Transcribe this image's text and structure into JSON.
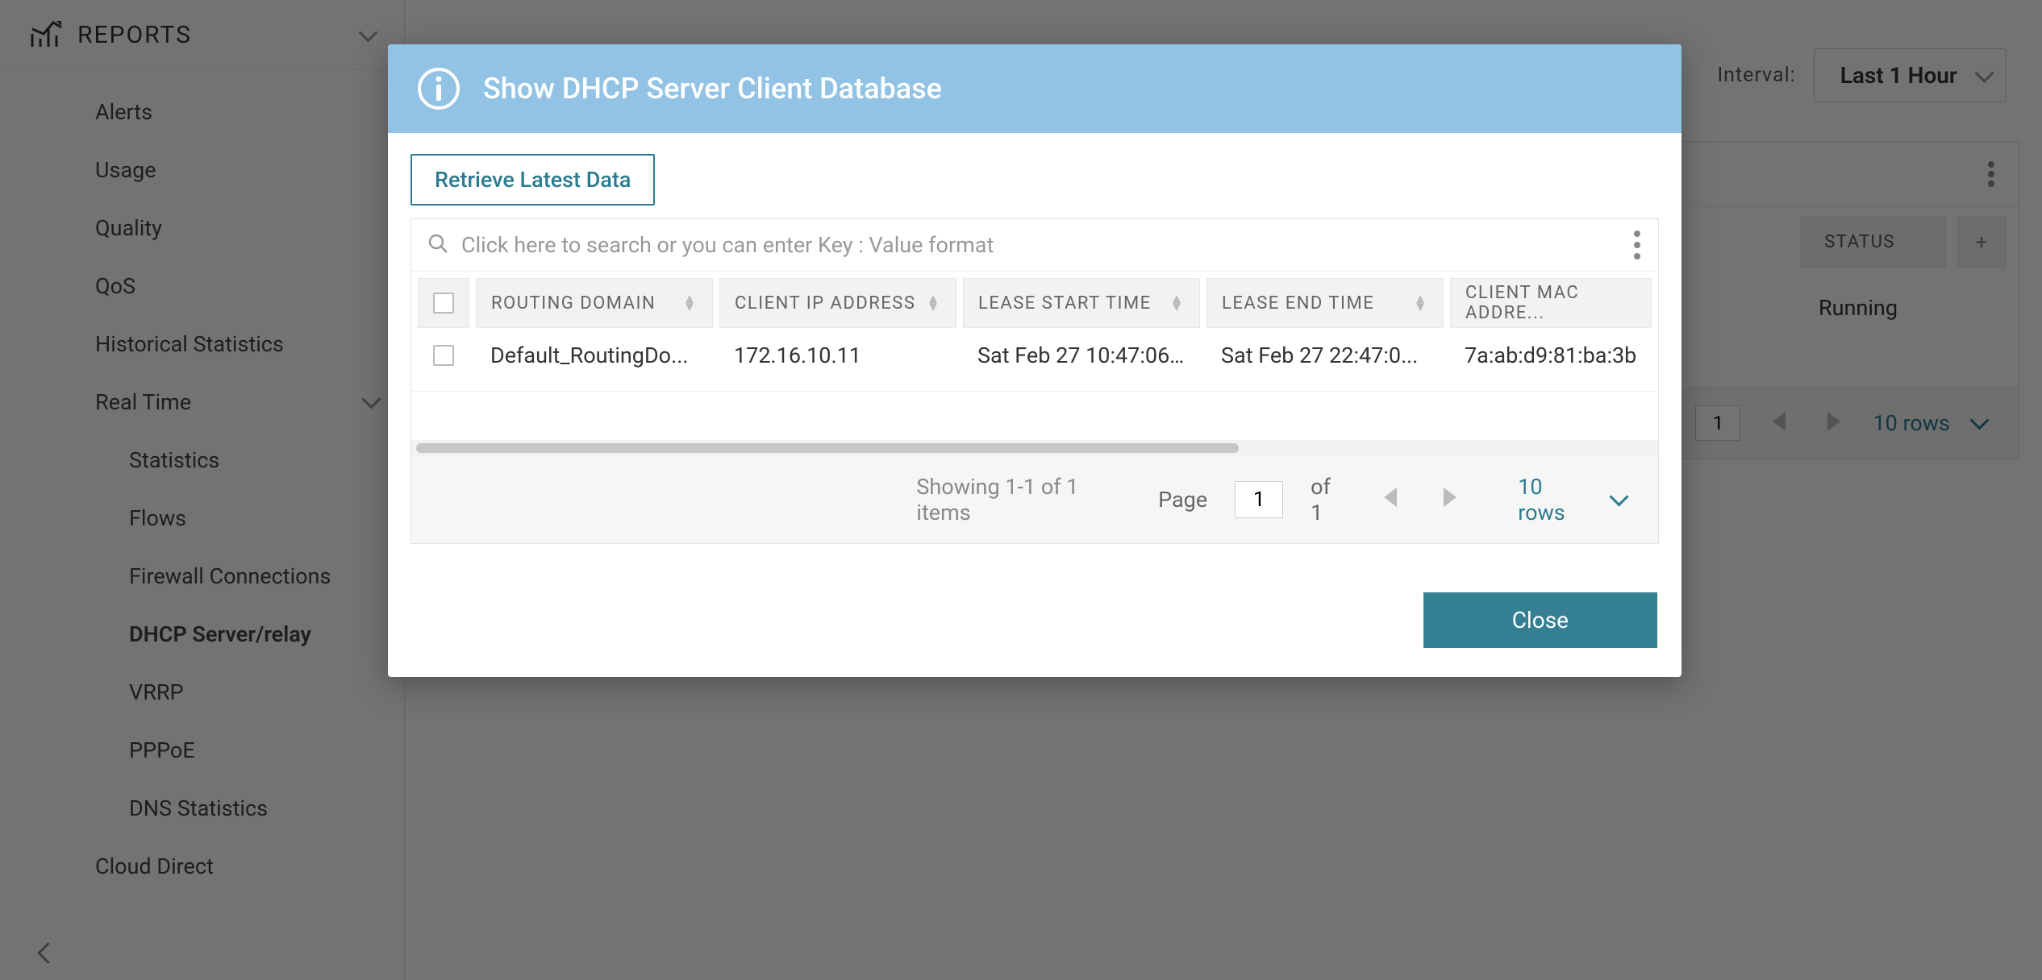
{
  "sidebar": {
    "header": "REPORTS",
    "items": {
      "alerts": "Alerts",
      "usage": "Usage",
      "quality": "Quality",
      "qos": "QoS",
      "historical": "Historical Statistics",
      "realtime": "Real Time",
      "cloud_direct": "Cloud Direct"
    },
    "realtime_children": {
      "statistics": "Statistics",
      "flows": "Flows",
      "firewall": "Firewall Connections",
      "dhcp": "DHCP Server/relay",
      "vrrp": "VRRP",
      "pppoe": "PPPoE",
      "dns": "DNS Statistics"
    }
  },
  "toolbar": {
    "interval_label": "Interval:",
    "interval_value": "Last 1 Hour"
  },
  "bgtable": {
    "col_status": "STATUS",
    "cell_status": "Running",
    "page_value": "1",
    "rows_label": "10 rows"
  },
  "modal": {
    "title": "Show DHCP Server Client Database",
    "retrieve_label": "Retrieve Latest Data",
    "search_placeholder": "Click here to search or you can enter Key : Value format",
    "columns": {
      "routing_domain": "ROUTING DOMAIN",
      "client_ip": "CLIENT IP ADDRESS",
      "lease_start": "LEASE START TIME",
      "lease_end": "LEASE END TIME",
      "client_mac": "CLIENT MAC ADDRE..."
    },
    "row": {
      "routing_domain": "Default_RoutingDo...",
      "client_ip": "172.16.10.11",
      "lease_start": "Sat Feb 27 10:47:06...",
      "lease_end": "Sat Feb 27 22:47:0...",
      "client_mac": "7a:ab:d9:81:ba:3b"
    },
    "pager": {
      "showing": "Showing 1-1 of 1 items",
      "page_label": "Page",
      "page_value": "1",
      "of_n": "of 1",
      "rows_label": "10 rows"
    },
    "close_label": "Close"
  }
}
